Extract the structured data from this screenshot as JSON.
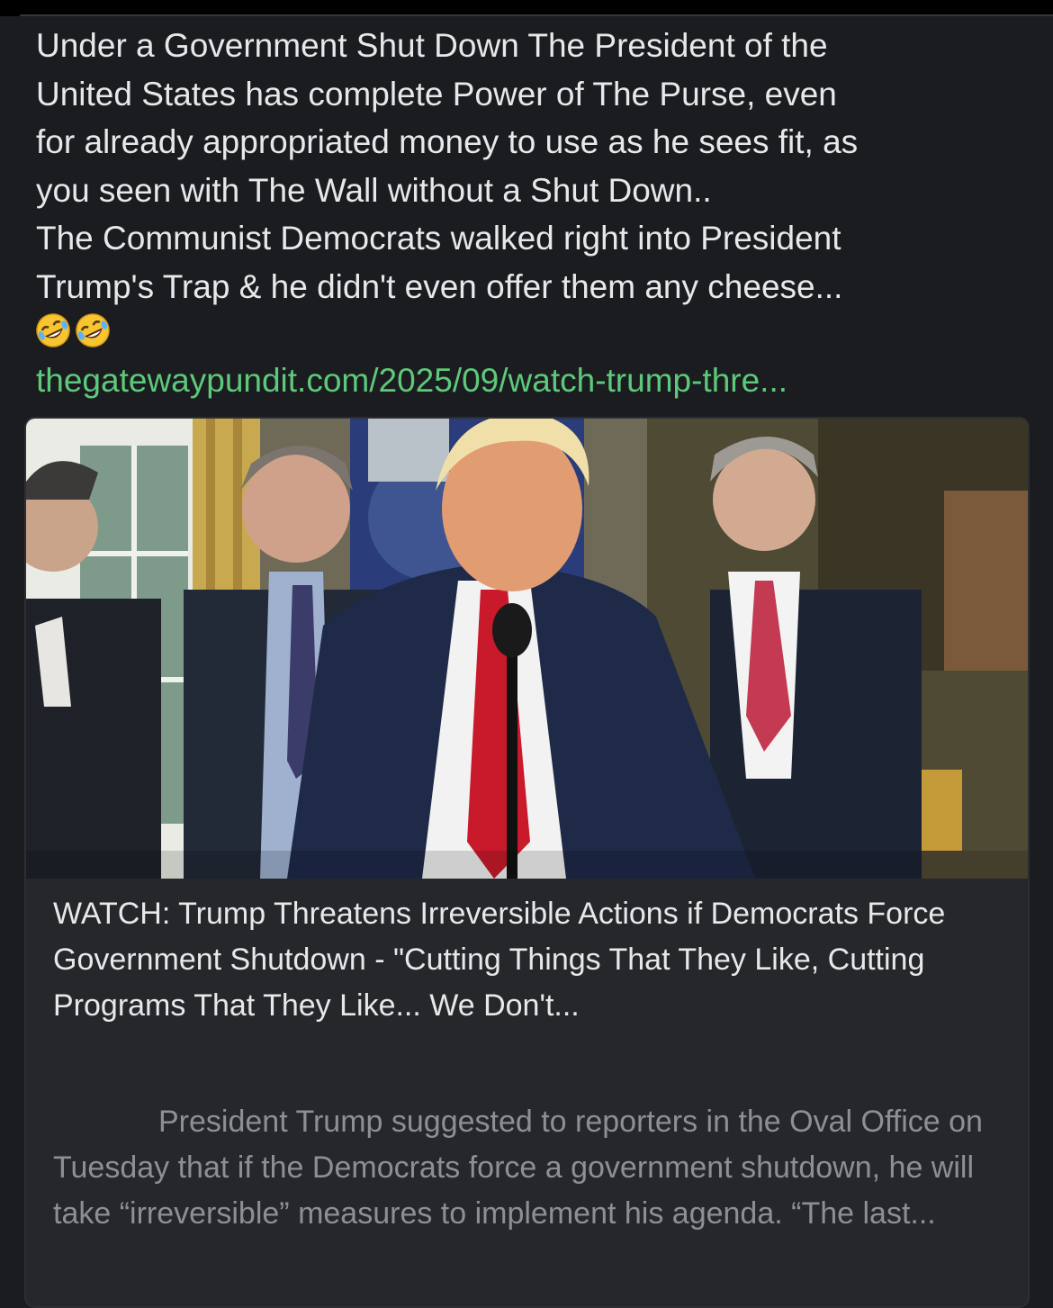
{
  "post": {
    "text": "Under a Government Shut Down The President of the\nUnited States has complete Power of The Purse, even\nfor already appropriated money to use as he sees fit, as\nyou seen with The Wall without a Shut Down..\nThe Communist Democrats walked right into President\nTrump's Trap & he didn't even offer them any cheese...",
    "emojis": [
      "rolling-on-floor-laughing",
      "rolling-on-floor-laughing"
    ],
    "link": "thegatewaypundit.com/2025/09/watch-trump-thre..."
  },
  "link_card": {
    "title": "WATCH: Trump Threatens Irreversible Actions if Democrats Force Government Shutdown - \"Cutting Things That They Like, Cutting Programs That They Like... We Don't...",
    "description": "President Trump suggested to reporters in the Oval Office on Tuesday that if the Democrats force a government shutdown, he will take “irreversible” measures to implement his agenda.  “The last..."
  },
  "colors": {
    "background": "#1b1c20",
    "text": "#e7e8ea",
    "link": "#5dc97a",
    "muted": "#8d8f94",
    "card": "#25272b"
  }
}
